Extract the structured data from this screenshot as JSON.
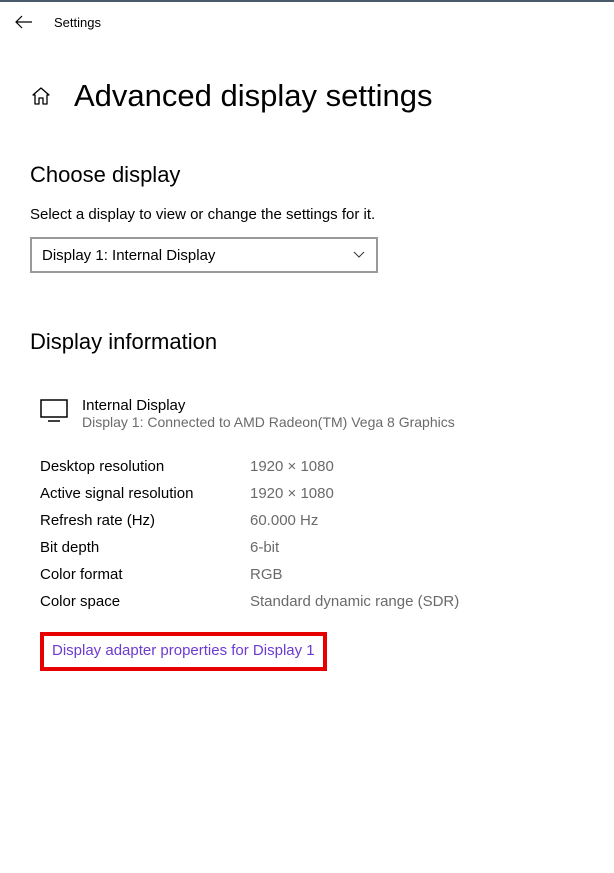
{
  "header": {
    "title": "Settings"
  },
  "page": {
    "title": "Advanced display settings"
  },
  "chooseDisplay": {
    "heading": "Choose display",
    "description": "Select a display to view or change the settings for it.",
    "selected": "Display 1: Internal Display"
  },
  "displayInfo": {
    "heading": "Display information",
    "displayName": "Internal Display",
    "connection": "Display 1: Connected to AMD Radeon(TM) Vega 8 Graphics",
    "rows": {
      "desktopResolution": {
        "label": "Desktop resolution",
        "value": "1920 × 1080"
      },
      "activeSignalResolution": {
        "label": "Active signal resolution",
        "value": "1920 × 1080"
      },
      "refreshRate": {
        "label": "Refresh rate (Hz)",
        "value": "60.000 Hz"
      },
      "bitDepth": {
        "label": "Bit depth",
        "value": "6-bit"
      },
      "colorFormat": {
        "label": "Color format",
        "value": "RGB"
      },
      "colorSpace": {
        "label": "Color space",
        "value": "Standard dynamic range (SDR)"
      }
    },
    "link": "Display adapter properties for Display 1"
  }
}
